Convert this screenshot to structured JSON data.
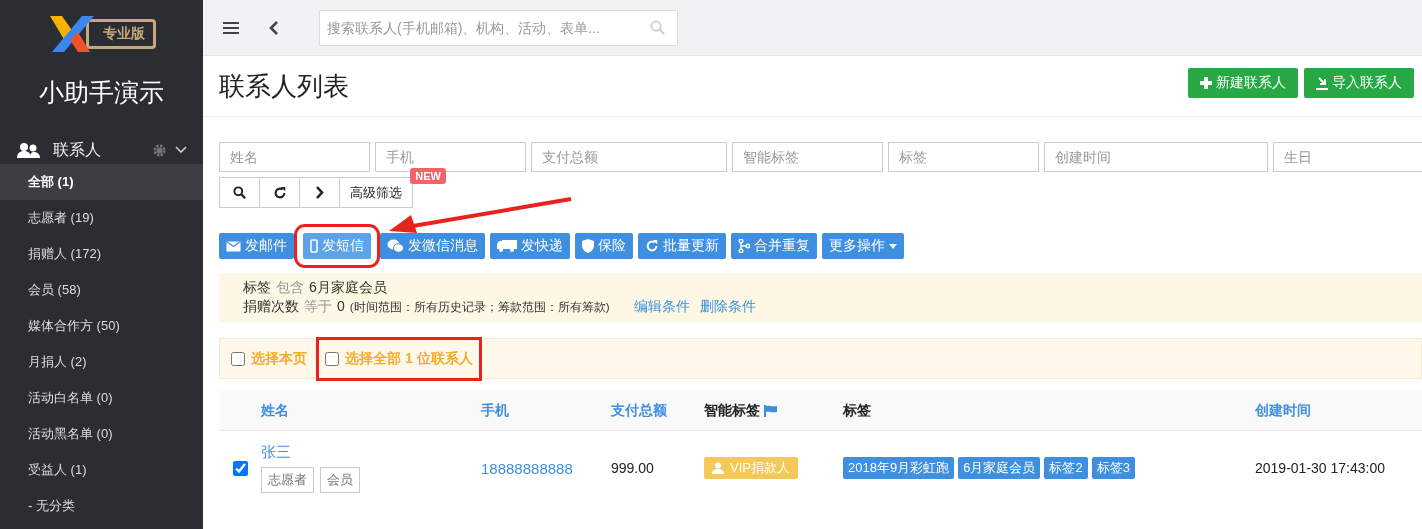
{
  "sidebar": {
    "badge": "专业版",
    "title": "小助手演示",
    "section": {
      "label": "联系人",
      "expanded": true
    },
    "items": [
      {
        "label": "全部 (1)",
        "selected": true
      },
      {
        "label": "志愿者 (19)",
        "selected": false
      },
      {
        "label": "捐赠人 (172)",
        "selected": false
      },
      {
        "label": "会员 (58)",
        "selected": false
      },
      {
        "label": "媒体合作方 (50)",
        "selected": false
      },
      {
        "label": "月捐人 (2)",
        "selected": false
      },
      {
        "label": "活动白名单 (0)",
        "selected": false
      },
      {
        "label": "活动黑名单 (0)",
        "selected": false
      },
      {
        "label": "受益人 (1)",
        "selected": false
      },
      {
        "label": "- 无分类",
        "selected": false
      }
    ]
  },
  "topbar": {
    "search": {
      "placeholder": "搜索联系人(手机邮箱)、机构、活动、表单..."
    }
  },
  "page": {
    "title": "联系人列表",
    "buttons": [
      {
        "label": "新建联系人",
        "kind": "plus"
      },
      {
        "label": "导入联系人",
        "kind": "import"
      }
    ]
  },
  "filters": [
    {
      "placeholder": "姓名"
    },
    {
      "placeholder": "手机"
    },
    {
      "placeholder": "支付总额"
    },
    {
      "placeholder": "智能标签"
    },
    {
      "placeholder": "标签"
    },
    {
      "placeholder": "创建时间"
    },
    {
      "placeholder": "生日"
    }
  ],
  "filter_tools": {
    "advanced": "高级筛选",
    "new_badge": "NEW"
  },
  "actions": [
    {
      "label": "发邮件",
      "kind": "mail",
      "highlighted": false
    },
    {
      "label": "发短信",
      "kind": "phone",
      "highlighted": true
    },
    {
      "label": "发微信消息",
      "kind": "wechat",
      "highlighted": false
    },
    {
      "label": "发快递",
      "kind": "truck",
      "highlighted": false
    },
    {
      "label": "保险",
      "kind": "shield",
      "highlighted": false
    },
    {
      "label": "批量更新",
      "kind": "refresh",
      "highlighted": false
    },
    {
      "label": "合并重复",
      "kind": "merge",
      "highlighted": false
    },
    {
      "label": "更多操作",
      "kind": "dropdown",
      "highlighted": false
    }
  ],
  "conditions": [
    {
      "field": "标签",
      "operator": "包含",
      "value": "6月家庭会员"
    },
    {
      "field": "捐赠次数",
      "operator": "等于",
      "value": "0",
      "note": "(时间范围：所有历史记录；筹款范围：所有筹款)"
    }
  ],
  "condition_links": [
    "编辑条件",
    "删除条件"
  ],
  "select_bar": [
    {
      "label": "选择本页",
      "checked": false,
      "highlighted": false
    },
    {
      "label": "选择全部 1 位联系人",
      "checked": false,
      "highlighted": true
    }
  ],
  "table": {
    "columns": [
      {
        "label": "姓名",
        "sortable": true
      },
      {
        "label": "手机",
        "sortable": true
      },
      {
        "label": "支付总额",
        "sortable": true
      },
      {
        "label": "智能标签",
        "sortable": false,
        "flag": true
      },
      {
        "label": "标签",
        "sortable": false
      },
      {
        "label": "创建时间",
        "sortable": true
      }
    ],
    "rows": [
      {
        "checked": true,
        "name": "张三",
        "groups": [
          "志愿者",
          "会员"
        ],
        "phone": "18888888888",
        "total": "999.00",
        "smart_tags": [
          "VIP捐款人"
        ],
        "tags": [
          "2018年9月彩虹跑",
          "6月家庭会员",
          "标签2",
          "标签3"
        ],
        "created": "2019-01-30 17:43:00"
      }
    ]
  }
}
